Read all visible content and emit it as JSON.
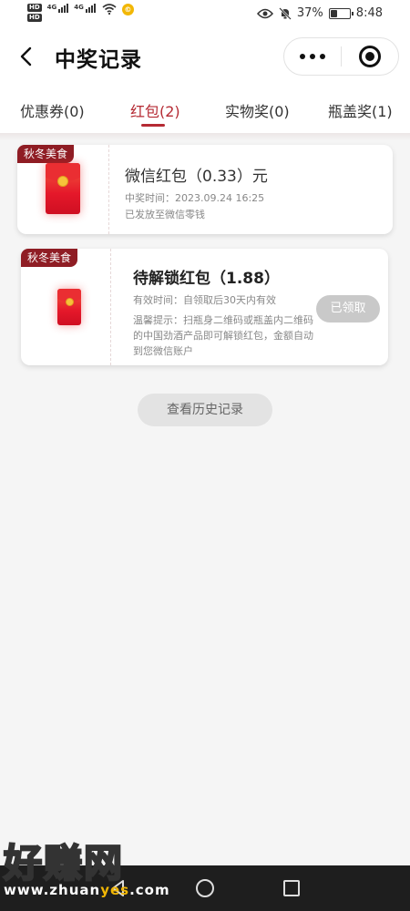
{
  "status_bar": {
    "hd_1": "HD",
    "hd_2": "HD",
    "network_1": "4G",
    "network_2": "4G",
    "battery_percent": "37%",
    "time": "8:48",
    "battery_level": 0.37
  },
  "header": {
    "title": "中奖记录"
  },
  "tabs": [
    {
      "label": "优惠券(0)",
      "active": false
    },
    {
      "label": "红包(2)",
      "active": true
    },
    {
      "label": "实物奖(0)",
      "active": false
    },
    {
      "label": "瓶盖奖(1)",
      "active": false
    }
  ],
  "records": [
    {
      "tag": "秋冬美食",
      "title": "微信红包（0.33）元",
      "line1": "中奖时间：2023.09.24 16:25",
      "line2": "已发放至微信零钱"
    },
    {
      "tag": "秋冬美食",
      "title": "待解锁红包（1.88）",
      "validity": "有效时间：自领取后30天内有效",
      "tip": "温馨提示：扫瓶身二维码或瓶盖内二维码的中国劲酒产品即可解锁红包，金额自动到您微信账户",
      "button": "已领取"
    }
  ],
  "history_button": "查看历史记录",
  "watermark": {
    "text": "好赚网",
    "url_prefix": "www.zhuan",
    "url_highlight": "yes",
    "url_suffix": ".com"
  },
  "colors": {
    "accent": "#b52a33",
    "tag_bg": "#8f1d24",
    "envelope": "#e5182a"
  },
  "icons": [
    "back-arrow-icon",
    "more-dots-icon",
    "close-target-icon",
    "red-envelope-icon",
    "eye-icon",
    "mute-bell-icon",
    "battery-icon",
    "wifi-icon",
    "signal-icon",
    "coin-icon"
  ]
}
